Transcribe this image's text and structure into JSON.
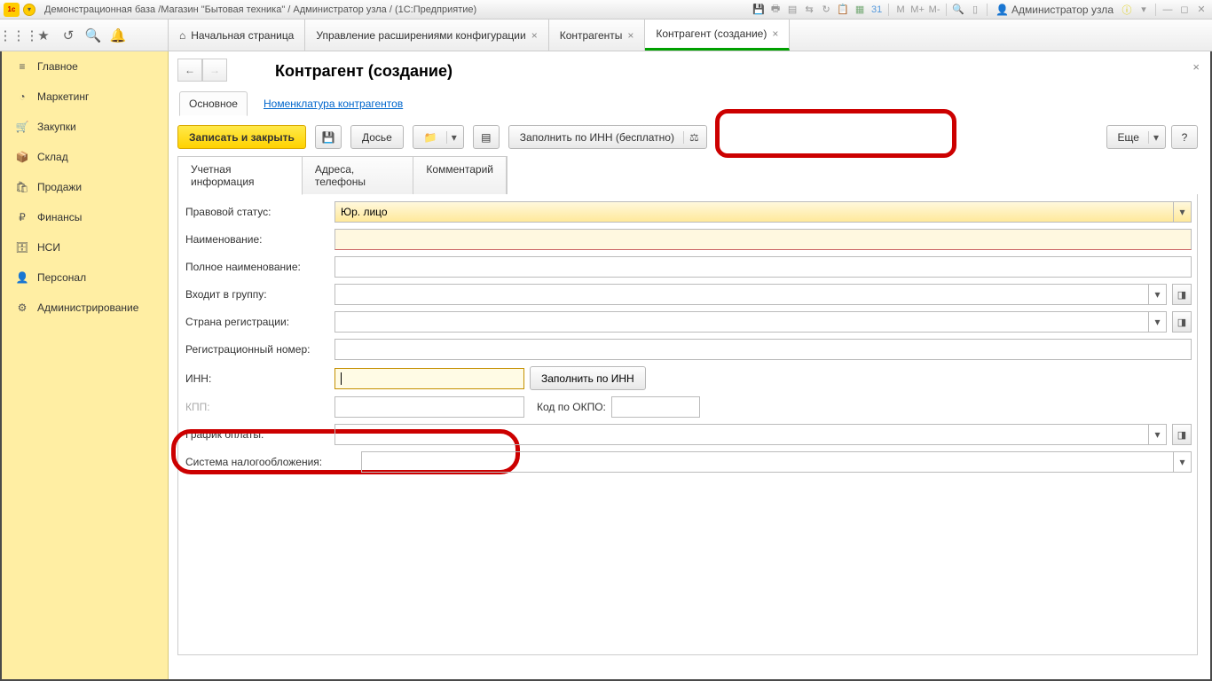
{
  "titlebar": {
    "title": "Демонстрационная база /Магазин \"Бытовая техника\" / Администратор узла /  (1С:Предприятие)",
    "admin_user": "Администратор узла"
  },
  "tabs": {
    "home": "Начальная страница",
    "t1": "Управление расширениями конфигурации",
    "t2": "Контрагенты",
    "t3": "Контрагент (создание)"
  },
  "sidebar": {
    "items": [
      {
        "label": "Главное"
      },
      {
        "label": "Маркетинг"
      },
      {
        "label": "Закупки"
      },
      {
        "label": "Склад"
      },
      {
        "label": "Продажи"
      },
      {
        "label": "Финансы"
      },
      {
        "label": "НСИ"
      },
      {
        "label": "Персонал"
      },
      {
        "label": "Администрирование"
      }
    ]
  },
  "page": {
    "title": "Контрагент (создание)",
    "subtab_main": "Основное",
    "subtab_nom": "Номенклатура контрагентов"
  },
  "toolbar": {
    "save_close": "Записать и закрыть",
    "dossier": "Досье",
    "fill_inn_free": "Заполнить по ИНН (бесплатно)",
    "more": "Еще",
    "help": "?"
  },
  "formtabs": {
    "t1": "Учетная информация",
    "t2": "Адреса, телефоны",
    "t3": "Комментарий"
  },
  "form": {
    "legal_status_label": "Правовой статус:",
    "legal_status_value": "Юр. лицо",
    "name_label": "Наименование:",
    "full_name_label": "Полное наименование:",
    "group_label": "Входит в группу:",
    "country_label": "Страна регистрации:",
    "regnum_label": "Регистрационный номер:",
    "inn_label": "ИНН:",
    "fill_inn_btn": "Заполнить по ИНН",
    "kpp_label": "КПП:",
    "okpo_label": "Код по ОКПО:",
    "schedule_label": "График оплаты:",
    "tax_label": "Система налогообложения:"
  }
}
